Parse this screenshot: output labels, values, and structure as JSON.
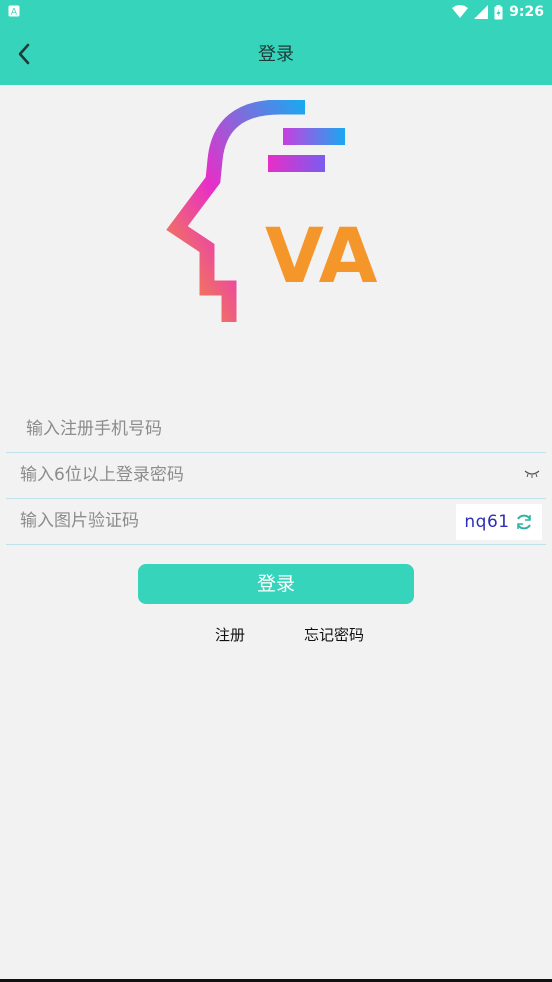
{
  "status": {
    "time": "9:26"
  },
  "appbar": {
    "title": "登录"
  },
  "logo": {
    "text": "VA"
  },
  "form": {
    "phone_placeholder": "输入注册手机号码",
    "password_placeholder": "输入6位以上登录密码",
    "captcha_placeholder": "输入图片验证码",
    "captcha_text": "nq61"
  },
  "actions": {
    "login_label": "登录",
    "register_label": "注册",
    "forgot_label": "忘记密码"
  },
  "colors": {
    "primary": "#35d4bb",
    "logo_orange": "#f5962a",
    "logo_magenta": "#e82ec8",
    "logo_blue": "#1aa8f0",
    "captcha_text": "#2d2fb8"
  },
  "icons": {
    "back": "chevron-left-icon",
    "password_toggle": "eye-closed-icon",
    "captcha_refresh": "refresh-icon",
    "wifi": "wifi-icon",
    "signal": "signal-icon",
    "battery": "battery-icon"
  }
}
